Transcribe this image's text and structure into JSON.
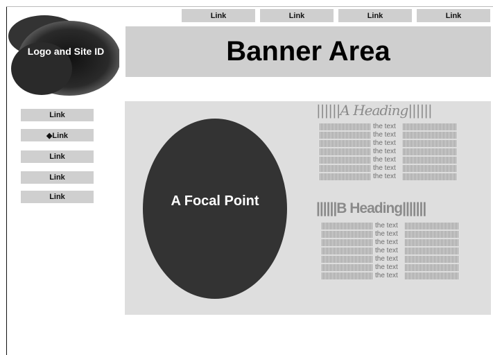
{
  "topnav": [
    "Link",
    "Link",
    "Link",
    "Link"
  ],
  "logo": {
    "label": "Logo and Site ID"
  },
  "banner": {
    "label": "Banner Area"
  },
  "sidenav": [
    "Link",
    "◆Link",
    "Link",
    "Link",
    "Link"
  ],
  "focal": {
    "label": "A Focal Point"
  },
  "sectionA": {
    "heading": "||||||A Heading||||||",
    "lines": [
      "the text",
      "the text",
      "the text",
      "the text",
      "the text",
      "the text",
      "the text"
    ]
  },
  "sectionB": {
    "heading": "||||||B Heading|||||||",
    "lines": [
      "the text",
      "the text",
      "the text",
      "the text",
      "the text",
      "the text",
      "the text"
    ]
  },
  "colors": {
    "gray_box": "#cfcfcf",
    "content_bg": "#dedede",
    "focal": "#333333"
  }
}
